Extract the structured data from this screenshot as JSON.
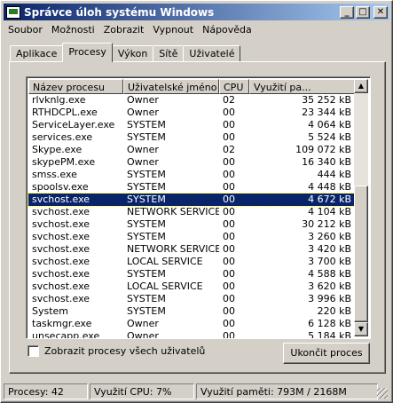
{
  "window": {
    "title": "Správce úloh systému Windows",
    "controls": {
      "minimize": "_",
      "maximize": "□",
      "close": "✕"
    }
  },
  "menu": [
    "Soubor",
    "Možnosti",
    "Zobrazit",
    "Vypnout",
    "Nápověda"
  ],
  "tabs": [
    "Aplikace",
    "Procesy",
    "Výkon",
    "Sítě",
    "Uživatelé"
  ],
  "active_tab": "Procesy",
  "columns": [
    "Název procesu",
    "Uživatelské jméno",
    "CPU",
    "Využití pa..."
  ],
  "processes": [
    {
      "name": "rlvknlg.exe",
      "user": "Owner",
      "cpu": "02",
      "mem": "35 252 kB"
    },
    {
      "name": "RTHDCPL.exe",
      "user": "Owner",
      "cpu": "00",
      "mem": "23 344 kB"
    },
    {
      "name": "ServiceLayer.exe",
      "user": "SYSTEM",
      "cpu": "00",
      "mem": "4 064 kB"
    },
    {
      "name": "services.exe",
      "user": "SYSTEM",
      "cpu": "00",
      "mem": "5 524 kB"
    },
    {
      "name": "Skype.exe",
      "user": "Owner",
      "cpu": "02",
      "mem": "109 072 kB"
    },
    {
      "name": "skypePM.exe",
      "user": "Owner",
      "cpu": "00",
      "mem": "16 340 kB"
    },
    {
      "name": "smss.exe",
      "user": "SYSTEM",
      "cpu": "00",
      "mem": "444 kB"
    },
    {
      "name": "spoolsv.exe",
      "user": "SYSTEM",
      "cpu": "00",
      "mem": "4 448 kB"
    },
    {
      "name": "svchost.exe",
      "user": "SYSTEM",
      "cpu": "00",
      "mem": "4 672 kB",
      "selected": true
    },
    {
      "name": "svchost.exe",
      "user": "NETWORK SERVICE",
      "cpu": "00",
      "mem": "4 104 kB"
    },
    {
      "name": "svchost.exe",
      "user": "SYSTEM",
      "cpu": "00",
      "mem": "30 212 kB"
    },
    {
      "name": "svchost.exe",
      "user": "SYSTEM",
      "cpu": "00",
      "mem": "3 260 kB"
    },
    {
      "name": "svchost.exe",
      "user": "NETWORK SERVICE",
      "cpu": "00",
      "mem": "3 420 kB"
    },
    {
      "name": "svchost.exe",
      "user": "LOCAL SERVICE",
      "cpu": "00",
      "mem": "3 700 kB"
    },
    {
      "name": "svchost.exe",
      "user": "SYSTEM",
      "cpu": "00",
      "mem": "4 588 kB"
    },
    {
      "name": "svchost.exe",
      "user": "LOCAL SERVICE",
      "cpu": "00",
      "mem": "3 620 kB"
    },
    {
      "name": "svchost.exe",
      "user": "SYSTEM",
      "cpu": "00",
      "mem": "3 996 kB"
    },
    {
      "name": "System",
      "user": "SYSTEM",
      "cpu": "00",
      "mem": "220 kB"
    },
    {
      "name": "taskmgr.exe",
      "user": "Owner",
      "cpu": "00",
      "mem": "6 128 kB"
    },
    {
      "name": "unsecapp.exe",
      "user": "Owner",
      "cpu": "00",
      "mem": "5 184 kB"
    }
  ],
  "show_all_users_label": "Zobrazit procesy všech uživatelů",
  "end_process_label": "Ukončit proces",
  "status": {
    "processes": "Procesy: 42",
    "cpu": "Využití CPU: 7%",
    "memory": "Využití paměti: 793M / 2168M"
  },
  "colors": {
    "selection": "#0a246a",
    "titlebar_start": "#0a246a",
    "titlebar_end": "#a6caf0",
    "face": "#d4d0c8"
  }
}
